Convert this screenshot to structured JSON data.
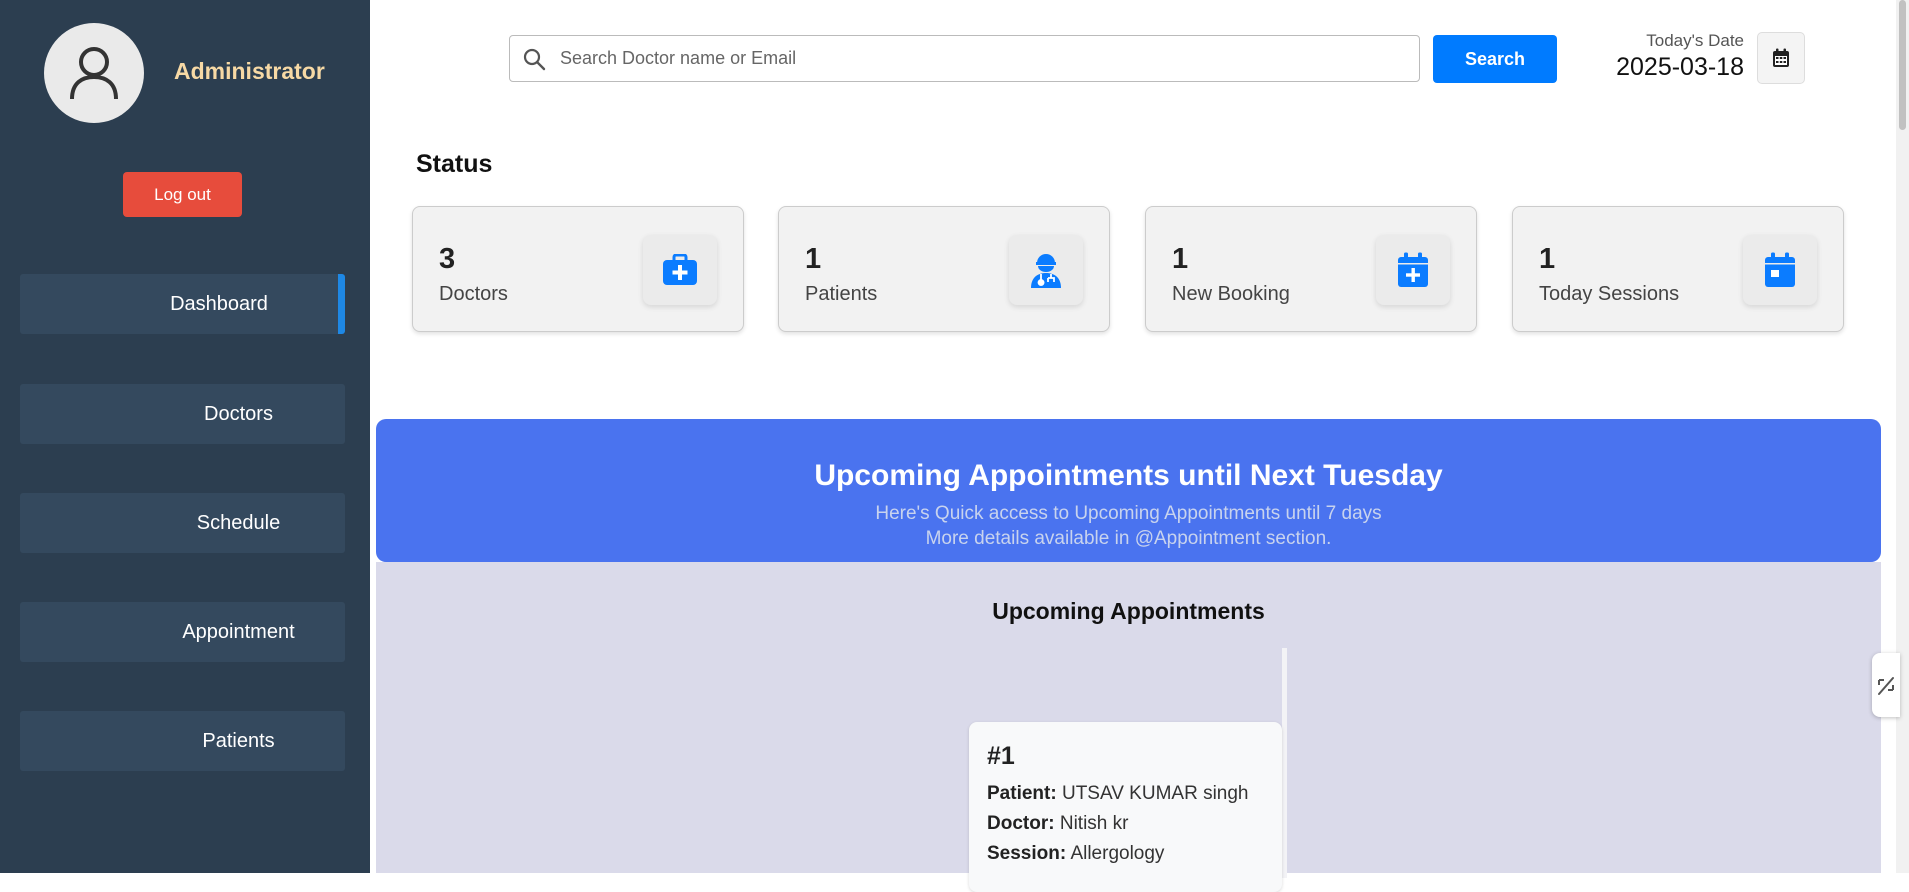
{
  "sidebar": {
    "admin_name": "Administrator",
    "logout_label": "Log out",
    "items": [
      {
        "label": "Dashboard",
        "active": true
      },
      {
        "label": "Doctors",
        "active": false
      },
      {
        "label": "Schedule",
        "active": false
      },
      {
        "label": "Appointment",
        "active": false
      },
      {
        "label": "Patients",
        "active": false
      }
    ]
  },
  "header": {
    "search_placeholder": "Search Doctor name or Email",
    "search_value": "",
    "search_button": "Search",
    "date_label": "Today's Date",
    "date_value": "2025-03-18"
  },
  "status": {
    "title": "Status",
    "cards": [
      {
        "value": "3",
        "label": "Doctors",
        "icon": "medical-kit-icon"
      },
      {
        "value": "1",
        "label": "Patients",
        "icon": "patient-icon"
      },
      {
        "value": "1",
        "label": "New Booking",
        "icon": "calendar-plus-icon"
      },
      {
        "value": "1",
        "label": "Today Sessions",
        "icon": "calendar-day-icon"
      }
    ]
  },
  "banner": {
    "title": "Upcoming Appointments until Next Tuesday",
    "subtitle_line1": "Here's Quick access to Upcoming Appointments until 7 days",
    "subtitle_line2": "More details available in @Appointment section."
  },
  "appointments": {
    "title": "Upcoming Appointments",
    "items": [
      {
        "number": "#1",
        "patient_label": "Patient:",
        "patient": "UTSAV KUMAR singh",
        "doctor_label": "Doctor:",
        "doctor": "Nitish kr",
        "session_label": "Session:",
        "session": "Allergology"
      }
    ]
  },
  "colors": {
    "sidebar_bg": "#2c3e50",
    "accent": "#007bff",
    "logout": "#e74c3c",
    "banner": "#4a73ef",
    "admin_name": "#f7d9a5"
  }
}
